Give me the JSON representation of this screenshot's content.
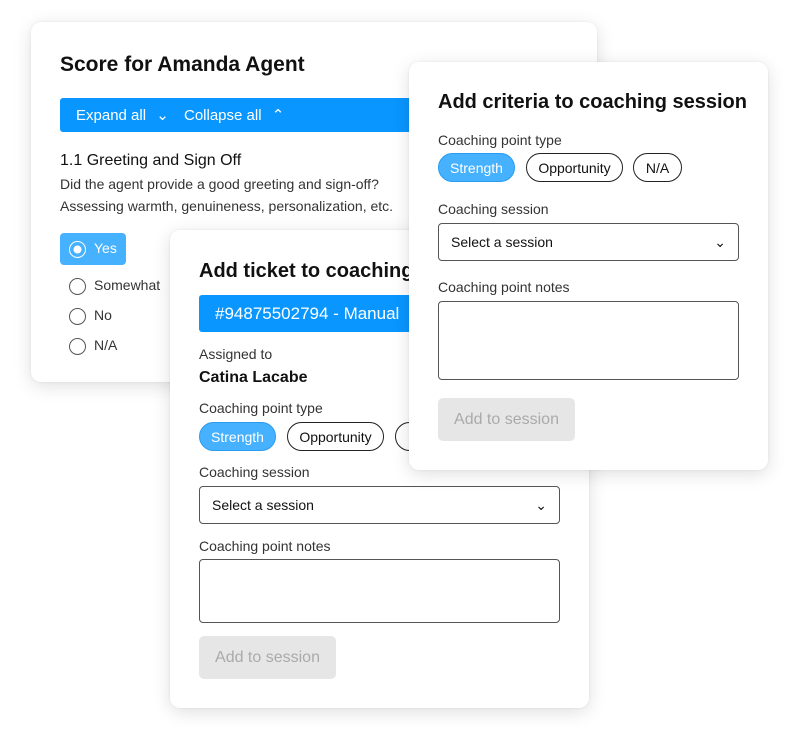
{
  "score_card": {
    "title": "Score for Amanda Agent",
    "expand_all": "Expand all",
    "collapse_all": "Collapse all",
    "section_title": "1.1 Greeting and Sign Off",
    "desc1": "Did the agent provide a good greeting and sign-off?",
    "desc2": "Assessing warmth, genuineness, personalization, etc.",
    "options": [
      "Yes",
      "Somewhat",
      "No",
      "N/A"
    ],
    "selected": "Yes"
  },
  "ticket_card": {
    "title": "Add ticket to coaching session",
    "ticket": "#94875502794 - Manual",
    "assigned_label": "Assigned to",
    "assignee": "Catina Lacabe",
    "type_label": "Coaching point type",
    "types": [
      "Strength",
      "Opportunity",
      "N/A"
    ],
    "selected_type": "Strength",
    "session_label": "Coaching session",
    "session_placeholder": "Select a session",
    "notes_label": "Coaching point notes",
    "submit": "Add to session"
  },
  "criteria_card": {
    "title": "Add criteria to coaching session",
    "type_label": "Coaching point type",
    "types": [
      "Strength",
      "Opportunity",
      "N/A"
    ],
    "selected_type": "Strength",
    "session_label": "Coaching session",
    "session_placeholder": "Select a session",
    "notes_label": "Coaching point notes",
    "submit": "Add to session"
  },
  "colors": {
    "accent": "#0a96ff",
    "selected_pill": "#45b1ff",
    "disabled": "#e6e6e6"
  }
}
